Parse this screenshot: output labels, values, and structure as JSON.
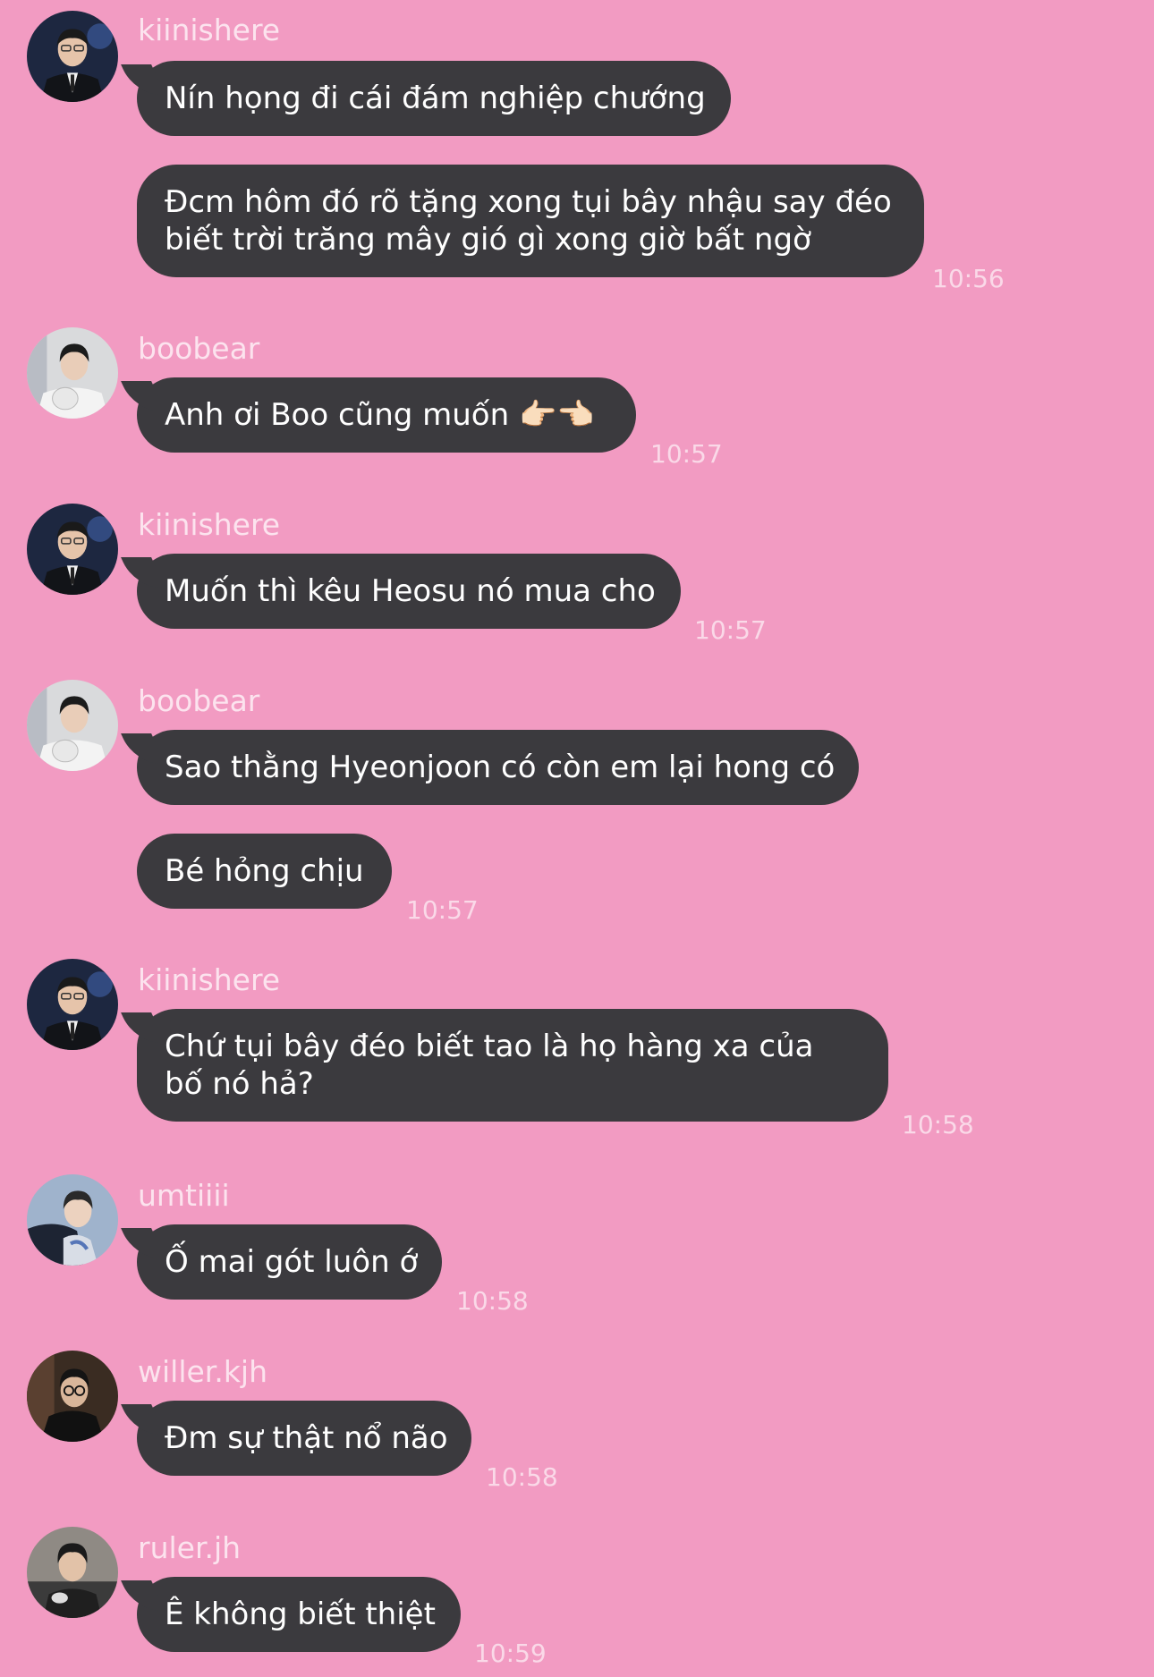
{
  "colors": {
    "background": "#f29bc2",
    "bubble": "#3b3a3e",
    "bubble_text": "#ffffff"
  },
  "messages": [
    {
      "sender": "kiinishere",
      "avatar": "kiin-avatar",
      "lines": [
        "Nín họng đi cái đám nghiệp chướng",
        "Đcm hôm đó rõ tặng xong tụi bây nhậu say đéo biết trời trăng mây gió gì xong giờ bất ngờ"
      ],
      "time": "10:56"
    },
    {
      "sender": "boobear",
      "avatar": "boobear-avatar",
      "lines": [
        "Anh ơi Boo cũng muốn 👉🏻👈🏻"
      ],
      "time": "10:57"
    },
    {
      "sender": "kiinishere",
      "avatar": "kiin-avatar",
      "lines": [
        "Muốn thì kêu Heosu nó mua cho"
      ],
      "time": "10:57"
    },
    {
      "sender": "boobear",
      "avatar": "boobear-avatar",
      "lines": [
        "Sao thằng Hyeonjoon có còn em lại hong có",
        "Bé hỏng chịu"
      ],
      "time": "10:57"
    },
    {
      "sender": "kiinishere",
      "avatar": "kiin-avatar",
      "lines": [
        "Chứ tụi bây đéo biết tao là họ hàng xa của bố nó hả?"
      ],
      "time": "10:58"
    },
    {
      "sender": "umtiiii",
      "avatar": "umtiiii-avatar",
      "lines": [
        "Ố mai gót luôn ớ"
      ],
      "time": "10:58"
    },
    {
      "sender": "willer.kjh",
      "avatar": "willer-avatar",
      "lines": [
        "Đm sự thật nổ não"
      ],
      "time": "10:58"
    },
    {
      "sender": "ruler.jh",
      "avatar": "ruler-avatar",
      "lines": [
        "Ê không biết thiệt"
      ],
      "time": "10:59"
    }
  ]
}
